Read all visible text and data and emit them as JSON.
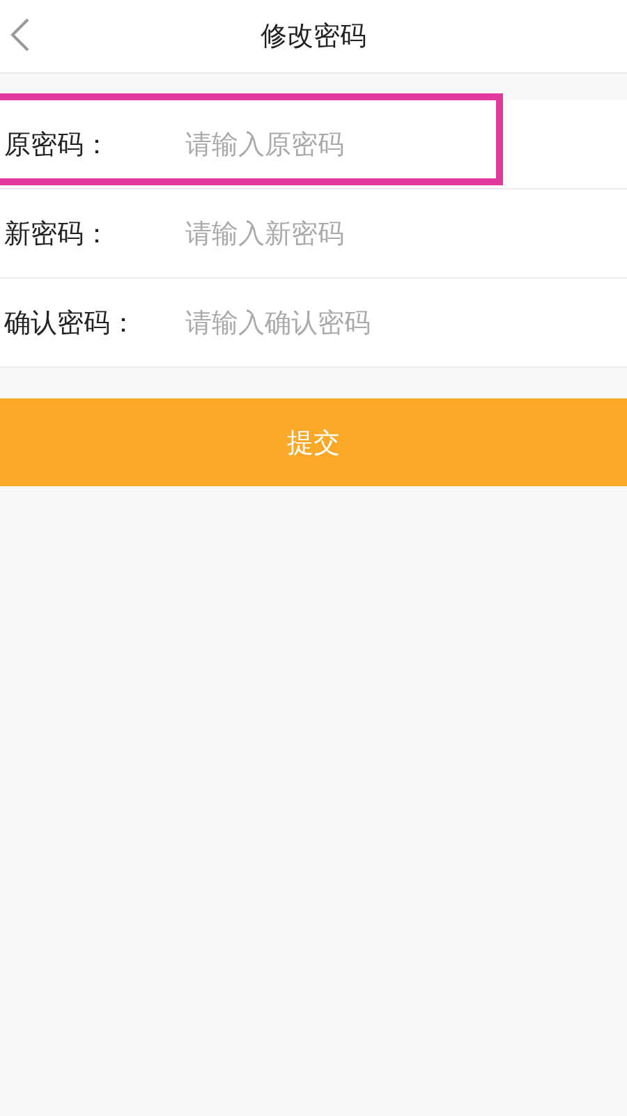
{
  "header": {
    "title": "修改密码"
  },
  "fields": [
    {
      "label": "原密码：",
      "placeholder": "请输入原密码",
      "highlighted": true
    },
    {
      "label": "新密码：",
      "placeholder": "请输入新密码",
      "highlighted": false
    },
    {
      "label": "确认密码：",
      "placeholder": "请输入确认密码",
      "highlighted": false
    }
  ],
  "submit": "提交"
}
